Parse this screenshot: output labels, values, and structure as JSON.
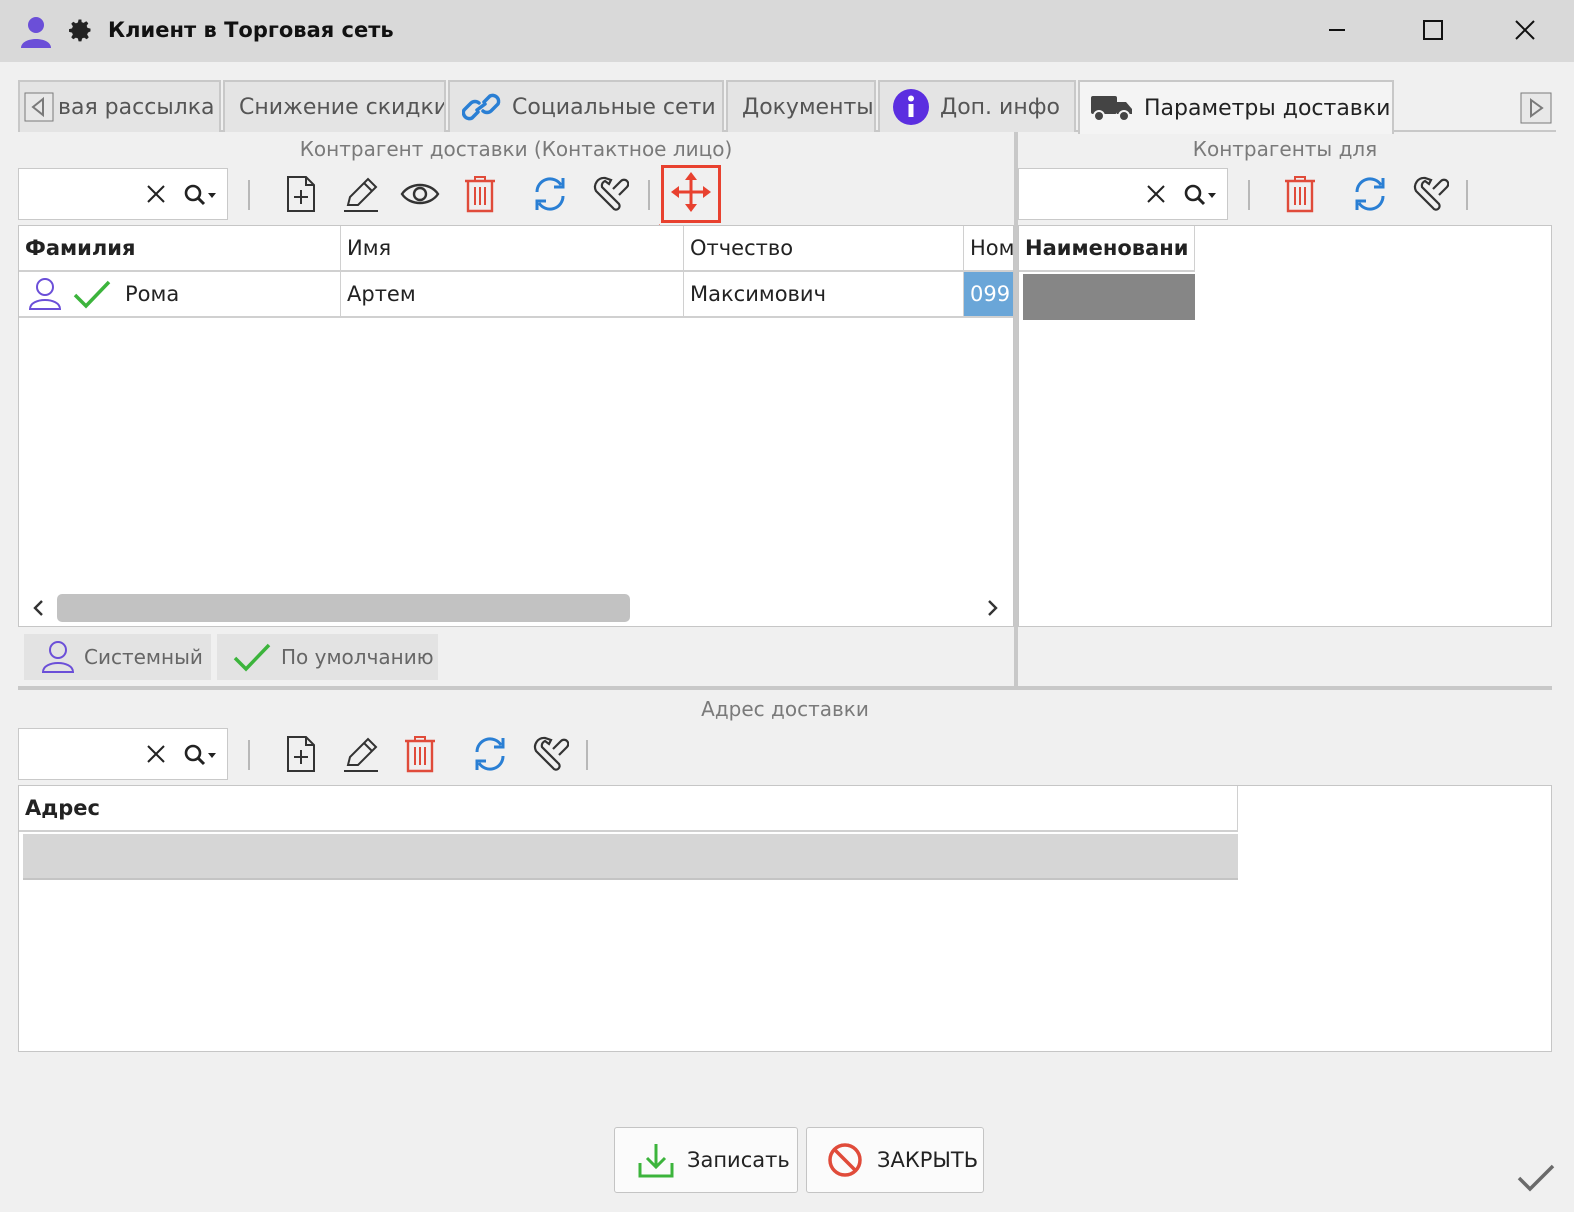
{
  "window": {
    "title": "Клиент в Торговая сеть"
  },
  "tabs": [
    {
      "label": "вая рассылка",
      "icon": "tab-scroll-left-icon"
    },
    {
      "label": "Снижение скидки"
    },
    {
      "label": "Социальные сети",
      "icon": "link-icon"
    },
    {
      "label": "Документы"
    },
    {
      "label": "Доп. инфо",
      "icon": "info-icon"
    },
    {
      "label": "Параметры доставки",
      "icon": "truck-icon",
      "active": true
    }
  ],
  "contact_section": {
    "title": "Контрагент доставки (Контактное лицо)",
    "search_value": "",
    "columns": [
      "Фамилия",
      "Имя",
      "Отчество",
      "Ном"
    ],
    "rows": [
      {
        "surname": "Рома",
        "name": "Артем",
        "patronymic": "Максимович",
        "number": "099",
        "system": true,
        "default": true
      }
    ],
    "legend": {
      "system": "Системный",
      "default": "По умолчанию"
    }
  },
  "counterparties_section": {
    "title": "Контрагенты для",
    "search_value": "",
    "columns": [
      "Наименовани"
    ]
  },
  "address_section": {
    "title": "Адрес доставки",
    "search_value": "",
    "columns": [
      "Адрес"
    ]
  },
  "footer": {
    "save_label": "Записать",
    "close_label": "ЗАКРЫТЬ"
  },
  "colors": {
    "accent_purple": "#6b4fd8",
    "icon_blue": "#2a7fd4",
    "icon_red": "#e04b3a",
    "check_green": "#3cb43c",
    "highlight_red": "#e8412f",
    "selected_cell": "#6aa6d8"
  }
}
